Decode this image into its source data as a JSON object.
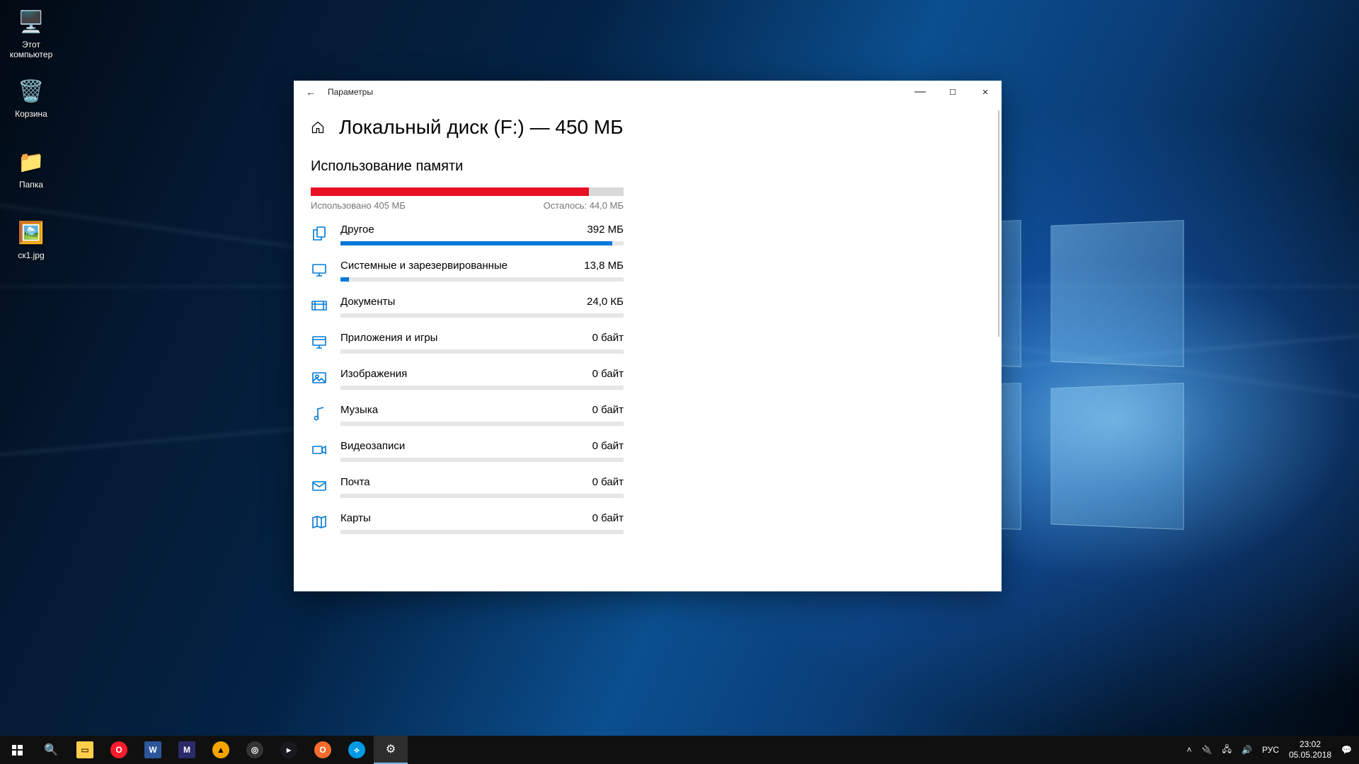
{
  "desktop_icons": [
    {
      "label": "Этот компьютер",
      "icon": "pc"
    },
    {
      "label": "Корзина",
      "icon": "bin"
    },
    {
      "label": "Папка",
      "icon": "folder"
    },
    {
      "label": "ск1.jpg",
      "icon": "img"
    }
  ],
  "window": {
    "app_name": "Параметры",
    "title": "Локальный диск (F:) — 450 МБ",
    "section": "Использование памяти",
    "used_label": "Использовано 405 МБ",
    "free_label": "Осталось: 44,0 МБ",
    "used_pct": 89,
    "categories": [
      {
        "name": "Другое",
        "size": "392 МБ",
        "pct": 96,
        "icon": "other"
      },
      {
        "name": "Системные и зарезервированные",
        "size": "13,8 МБ",
        "pct": 3,
        "icon": "system"
      },
      {
        "name": "Документы",
        "size": "24,0 КБ",
        "pct": 0,
        "icon": "docs"
      },
      {
        "name": "Приложения и игры",
        "size": "0 байт",
        "pct": 0,
        "icon": "apps"
      },
      {
        "name": "Изображения",
        "size": "0 байт",
        "pct": 0,
        "icon": "images"
      },
      {
        "name": "Музыка",
        "size": "0 байт",
        "pct": 0,
        "icon": "music"
      },
      {
        "name": "Видеозаписи",
        "size": "0 байт",
        "pct": 0,
        "icon": "video"
      },
      {
        "name": "Почта",
        "size": "0 байт",
        "pct": 0,
        "icon": "mail"
      },
      {
        "name": "Карты",
        "size": "0 байт",
        "pct": 0,
        "icon": "maps"
      }
    ]
  },
  "taskbar": {
    "apps": [
      "start",
      "search",
      "explorer",
      "opera",
      "word",
      "m",
      "aimp",
      "game",
      "steam",
      "origin",
      "bnet",
      "settings"
    ],
    "tray_lang": "РУС",
    "clock_time": "23:02",
    "clock_date": "05.05.2018"
  }
}
